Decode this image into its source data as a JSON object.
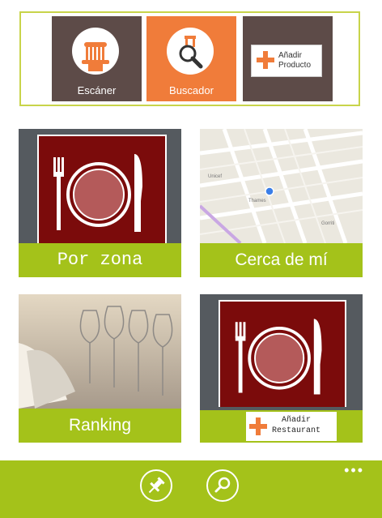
{
  "top_actions": {
    "scanner_label": "Escáner",
    "search_label": "Buscador",
    "add_product_line1": "Añadir",
    "add_product_line2": "Producto"
  },
  "tiles": {
    "por_zona": "Por zona",
    "cerca": "Cerca de mí",
    "ranking": "Ranking",
    "add_restaurant_line1": "Añadir",
    "add_restaurant_line2": "Restaurant"
  },
  "map_labels": {
    "street1": "Unicef",
    "street2": "Gorriti",
    "street3": "Thames"
  },
  "app_bar": {
    "more": "•••"
  },
  "colors": {
    "accent_green": "#a4c21a",
    "tile_brown": "#5d4b48",
    "tile_orange": "#f07c3a",
    "plate_red": "#7b0b0b"
  }
}
